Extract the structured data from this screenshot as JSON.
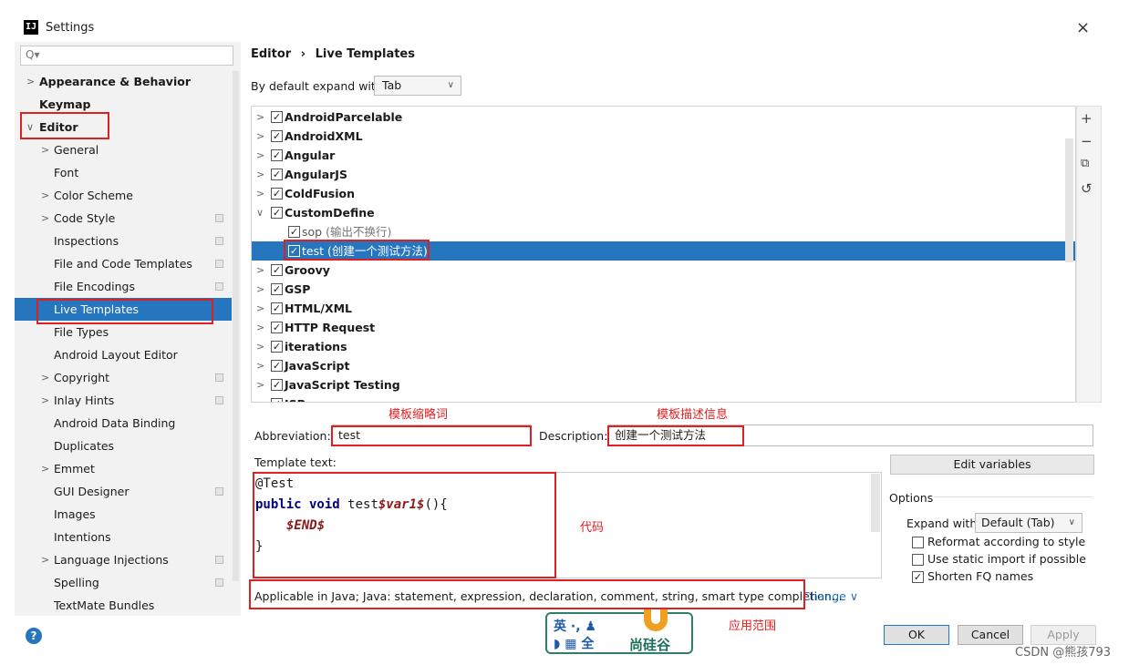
{
  "window": {
    "title": "Settings",
    "app_icon": "IJ",
    "close_icon": "×"
  },
  "search": {
    "placeholder": "Q▾"
  },
  "sidebar": {
    "items": [
      {
        "label": "Appearance & Behavior",
        "arrow": ">"
      },
      {
        "label": "Keymap",
        "arrow": ""
      },
      {
        "label": "Editor",
        "arrow": "∨"
      },
      {
        "label": "General",
        "arrow": ">"
      },
      {
        "label": "Font",
        "arrow": ""
      },
      {
        "label": "Color Scheme",
        "arrow": ">"
      },
      {
        "label": "Code Style",
        "arrow": ">"
      },
      {
        "label": "Inspections",
        "arrow": ""
      },
      {
        "label": "File and Code Templates",
        "arrow": ""
      },
      {
        "label": "File Encodings",
        "arrow": ""
      },
      {
        "label": "Live Templates",
        "arrow": ""
      },
      {
        "label": "File Types",
        "arrow": ""
      },
      {
        "label": "Android Layout Editor",
        "arrow": ""
      },
      {
        "label": "Copyright",
        "arrow": ">"
      },
      {
        "label": "Inlay Hints",
        "arrow": ">"
      },
      {
        "label": "Android Data Binding",
        "arrow": ""
      },
      {
        "label": "Duplicates",
        "arrow": ""
      },
      {
        "label": "Emmet",
        "arrow": ">"
      },
      {
        "label": "GUI Designer",
        "arrow": ""
      },
      {
        "label": "Images",
        "arrow": ""
      },
      {
        "label": "Intentions",
        "arrow": ""
      },
      {
        "label": "Language Injections",
        "arrow": ">"
      },
      {
        "label": "Spelling",
        "arrow": ""
      },
      {
        "label": "TextMate Bundles",
        "arrow": ""
      }
    ]
  },
  "breadcrumb": {
    "part1": "Editor",
    "sep": "›",
    "part2": "Live Templates"
  },
  "expand_default": {
    "label": "By default expand with",
    "value": "Tab"
  },
  "template_groups": [
    {
      "arrow": ">",
      "label": "AndroidParcelable",
      "sub": ""
    },
    {
      "arrow": ">",
      "label": "AndroidXML",
      "sub": ""
    },
    {
      "arrow": ">",
      "label": "Angular",
      "sub": ""
    },
    {
      "arrow": ">",
      "label": "AngularJS",
      "sub": ""
    },
    {
      "arrow": ">",
      "label": "ColdFusion",
      "sub": ""
    },
    {
      "arrow": "∨",
      "label": "CustomDefine",
      "sub": ""
    },
    {
      "arrow": "",
      "label": "sop",
      "sub": "(输出不换行)"
    },
    {
      "arrow": "",
      "label": "test",
      "sub": "(创建一个测试方法)"
    },
    {
      "arrow": ">",
      "label": "Groovy",
      "sub": ""
    },
    {
      "arrow": ">",
      "label": "GSP",
      "sub": ""
    },
    {
      "arrow": ">",
      "label": "HTML/XML",
      "sub": ""
    },
    {
      "arrow": ">",
      "label": "HTTP Request",
      "sub": ""
    },
    {
      "arrow": ">",
      "label": "iterations",
      "sub": ""
    },
    {
      "arrow": ">",
      "label": "JavaScript",
      "sub": ""
    },
    {
      "arrow": ">",
      "label": "JavaScript Testing",
      "sub": ""
    },
    {
      "arrow": ">",
      "label": "JSP",
      "sub": ""
    }
  ],
  "checkmark": "✓",
  "side_tools": {
    "add": "+",
    "remove": "−",
    "copy": "⧉",
    "restore": "↺"
  },
  "annotations": {
    "abbr_note": "模板缩略词",
    "desc_note": "模板描述信息",
    "code_note": "代码",
    "scope_note": "应用范围"
  },
  "abbreviation": {
    "label": "Abbreviation:",
    "value": "test"
  },
  "description": {
    "label": "Description:",
    "value": "创建一个测试方法"
  },
  "template_text": {
    "label": "Template text:",
    "line1": "@Test",
    "line2_kw": "public void ",
    "line2_name": "test",
    "line2_var": "$var1$",
    "line2_tail": "(){",
    "line3_var": "$END$",
    "line4": "}"
  },
  "applicable": {
    "text": "Applicable in Java; Java: statement, expression, declaration, comment, string, smart type completion...",
    "change": "Change ∨"
  },
  "edit_variables": "Edit variables",
  "options": {
    "label": "Options",
    "expand_with_label": "Expand with",
    "expand_with_value": "Default (Tab)",
    "items": [
      {
        "label": "Reformat according to style",
        "checked": false
      },
      {
        "label": "Use static import if possible",
        "checked": false
      },
      {
        "label": "Shorten FQ names",
        "checked": true
      }
    ]
  },
  "buttons": {
    "help": "?",
    "ok": "OK",
    "cancel": "Cancel",
    "apply": "Apply"
  },
  "ime": {
    "line1": "英 ·, ♟",
    "line2": "◗ ▦ 全",
    "brand": "尚硅谷"
  },
  "watermark": "CSDN @熊孩793"
}
